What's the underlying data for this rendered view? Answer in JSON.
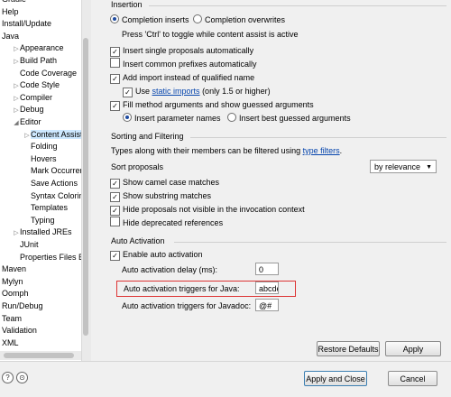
{
  "tree": {
    "items": [
      {
        "label": "Gradle",
        "indent": 0,
        "twisty": ""
      },
      {
        "label": "Help",
        "indent": 0,
        "twisty": ""
      },
      {
        "label": "Install/Update",
        "indent": 0,
        "twisty": ""
      },
      {
        "label": "Java",
        "indent": 0,
        "twisty": ""
      },
      {
        "label": "Appearance",
        "indent": 1,
        "twisty": "▷"
      },
      {
        "label": "Build Path",
        "indent": 1,
        "twisty": "▷"
      },
      {
        "label": "Code Coverage",
        "indent": 1,
        "twisty": ""
      },
      {
        "label": "Code Style",
        "indent": 1,
        "twisty": "▷"
      },
      {
        "label": "Compiler",
        "indent": 1,
        "twisty": "▷"
      },
      {
        "label": "Debug",
        "indent": 1,
        "twisty": "▷"
      },
      {
        "label": "Editor",
        "indent": 1,
        "twisty": "◢"
      },
      {
        "label": "Content Assist",
        "indent": 2,
        "twisty": "▷",
        "selected": true
      },
      {
        "label": "Folding",
        "indent": 2,
        "twisty": ""
      },
      {
        "label": "Hovers",
        "indent": 2,
        "twisty": ""
      },
      {
        "label": "Mark Occurren",
        "indent": 2,
        "twisty": ""
      },
      {
        "label": "Save Actions",
        "indent": 2,
        "twisty": ""
      },
      {
        "label": "Syntax Coloring",
        "indent": 2,
        "twisty": ""
      },
      {
        "label": "Templates",
        "indent": 2,
        "twisty": ""
      },
      {
        "label": "Typing",
        "indent": 2,
        "twisty": ""
      },
      {
        "label": "Installed JREs",
        "indent": 1,
        "twisty": "▷"
      },
      {
        "label": "JUnit",
        "indent": 1,
        "twisty": ""
      },
      {
        "label": "Properties Files Ed",
        "indent": 1,
        "twisty": ""
      },
      {
        "label": "Maven",
        "indent": 0,
        "twisty": ""
      },
      {
        "label": "Mylyn",
        "indent": 0,
        "twisty": ""
      },
      {
        "label": "Oomph",
        "indent": 0,
        "twisty": ""
      },
      {
        "label": "Run/Debug",
        "indent": 0,
        "twisty": ""
      },
      {
        "label": "Team",
        "indent": 0,
        "twisty": ""
      },
      {
        "label": "Validation",
        "indent": 0,
        "twisty": ""
      },
      {
        "label": "XML",
        "indent": 0,
        "twisty": ""
      }
    ]
  },
  "insertion": {
    "title": "Insertion",
    "completion_inserts": "Completion inserts",
    "completion_overwrites": "Completion overwrites",
    "toggle_hint": "Press 'Ctrl' to toggle while content assist is active",
    "insert_single": "Insert single proposals automatically",
    "insert_common": "Insert common prefixes automatically",
    "add_import": "Add import instead of qualified name",
    "use_prefix": "Use",
    "static_imports_link": "static imports",
    "use_suffix": "(only 1.5 or higher)",
    "fill_method": "Fill method arguments and show guessed arguments",
    "insert_param_names": "Insert parameter names",
    "insert_best_guessed": "Insert best guessed arguments"
  },
  "sorting": {
    "title": "Sorting and Filtering",
    "types_prefix": "Types along with their members can be filtered using",
    "type_filters_link": "type filters",
    "types_suffix": ".",
    "sort_label": "Sort proposals",
    "sort_value": "by relevance",
    "camel_case": "Show camel case matches",
    "substring": "Show substring matches",
    "hide_invisible": "Hide proposals not visible in the invocation context",
    "hide_deprecated": "Hide deprecated references"
  },
  "auto_activation": {
    "title": "Auto Activation",
    "enable": "Enable auto activation",
    "delay_label": "Auto activation delay (ms):",
    "delay_value": "0",
    "java_label": "Auto activation triggers for Java:",
    "java_value": "abcde",
    "javadoc_label": "Auto activation triggers for Javadoc:",
    "javadoc_value": "@#"
  },
  "buttons": {
    "restore_defaults": "Restore Defaults",
    "apply": "Apply",
    "apply_and_close": "Apply and Close",
    "cancel": "Cancel"
  },
  "icons": {
    "help": "?",
    "import": "⊙"
  },
  "colors": {
    "highlight_border": "#dd3333",
    "selection": "#cde8ff",
    "link": "#0645ad"
  }
}
